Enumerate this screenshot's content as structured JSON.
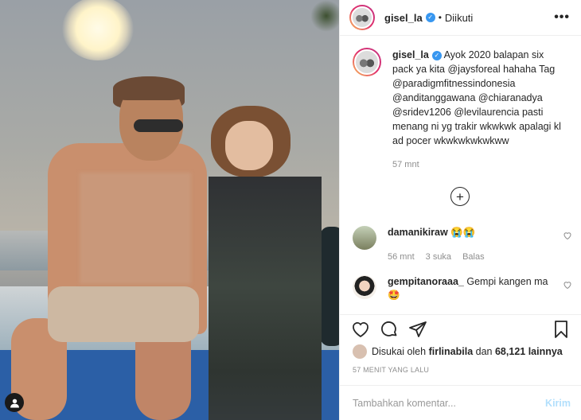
{
  "header": {
    "username": "gisel_la",
    "separator": "•",
    "follow_status": "Diikuti",
    "more_label": "•••"
  },
  "caption": {
    "username": "gisel_la",
    "text": "Ayok 2020 balapan six pack ya kita @jaysforeal hahaha Tag @paradigmfitnessindonesia @anditanggawana @chiaranadya @sridev1206 @levilaurencia pasti menang ni yg trakir wkwkwk apalagi kl ad pocer wkwkwkwkwkww",
    "time": "57 mnt"
  },
  "load_more_icon": "plus-circle-icon",
  "comments": [
    {
      "username": "damanikiraw",
      "text": "😭😭",
      "time": "56 mnt",
      "likes": "3 suka",
      "reply": "Balas"
    },
    {
      "username": "gempitanoraaa_",
      "text": "Gempi kangen ma 🤩"
    }
  ],
  "likes": {
    "prefix": "Disukai oleh",
    "user": "firlinabila",
    "middle": "dan",
    "count": "68,121 lainnya"
  },
  "post_time": "57 MENIT YANG LALU",
  "comment_box": {
    "placeholder": "Tambahkan komentar...",
    "post_label": "Kirim"
  },
  "colors": {
    "verified": "#3897f0",
    "post_disabled": "#b2dffc",
    "muted": "#8e8e8e"
  }
}
